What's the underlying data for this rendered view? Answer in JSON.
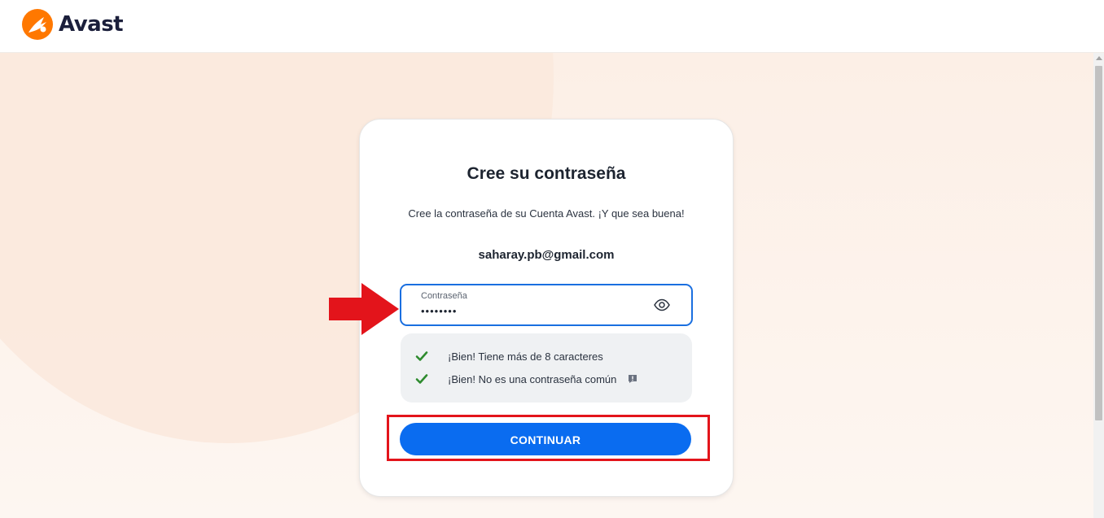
{
  "header": {
    "brand": "Avast",
    "logo_icon": "avast-logo-icon",
    "brand_color": "#FF7800"
  },
  "card": {
    "title": "Cree su contraseña",
    "subtitle": "Cree la contraseña de su Cuenta Avast. ¡Y que sea buena!",
    "email": "saharay.pb@gmail.com",
    "password_field": {
      "label": "Contraseña",
      "value": "••••••••",
      "toggle_icon": "eye-icon"
    },
    "checks": [
      {
        "icon": "check-icon",
        "text": "¡Bien! Tiene más de 8 caracteres"
      },
      {
        "icon": "check-icon",
        "text": "¡Bien! No es una contraseña común",
        "extra_icon": "info-icon"
      }
    ],
    "continue_label": "CONTINUAR"
  },
  "colors": {
    "accent_blue": "#0A6CF0",
    "check_green": "#2E8B2E",
    "annotation_red": "#E3141B"
  },
  "annotations": {
    "arrow_icon": "red-arrow-icon",
    "highlight_box": "red-highlight-box"
  }
}
